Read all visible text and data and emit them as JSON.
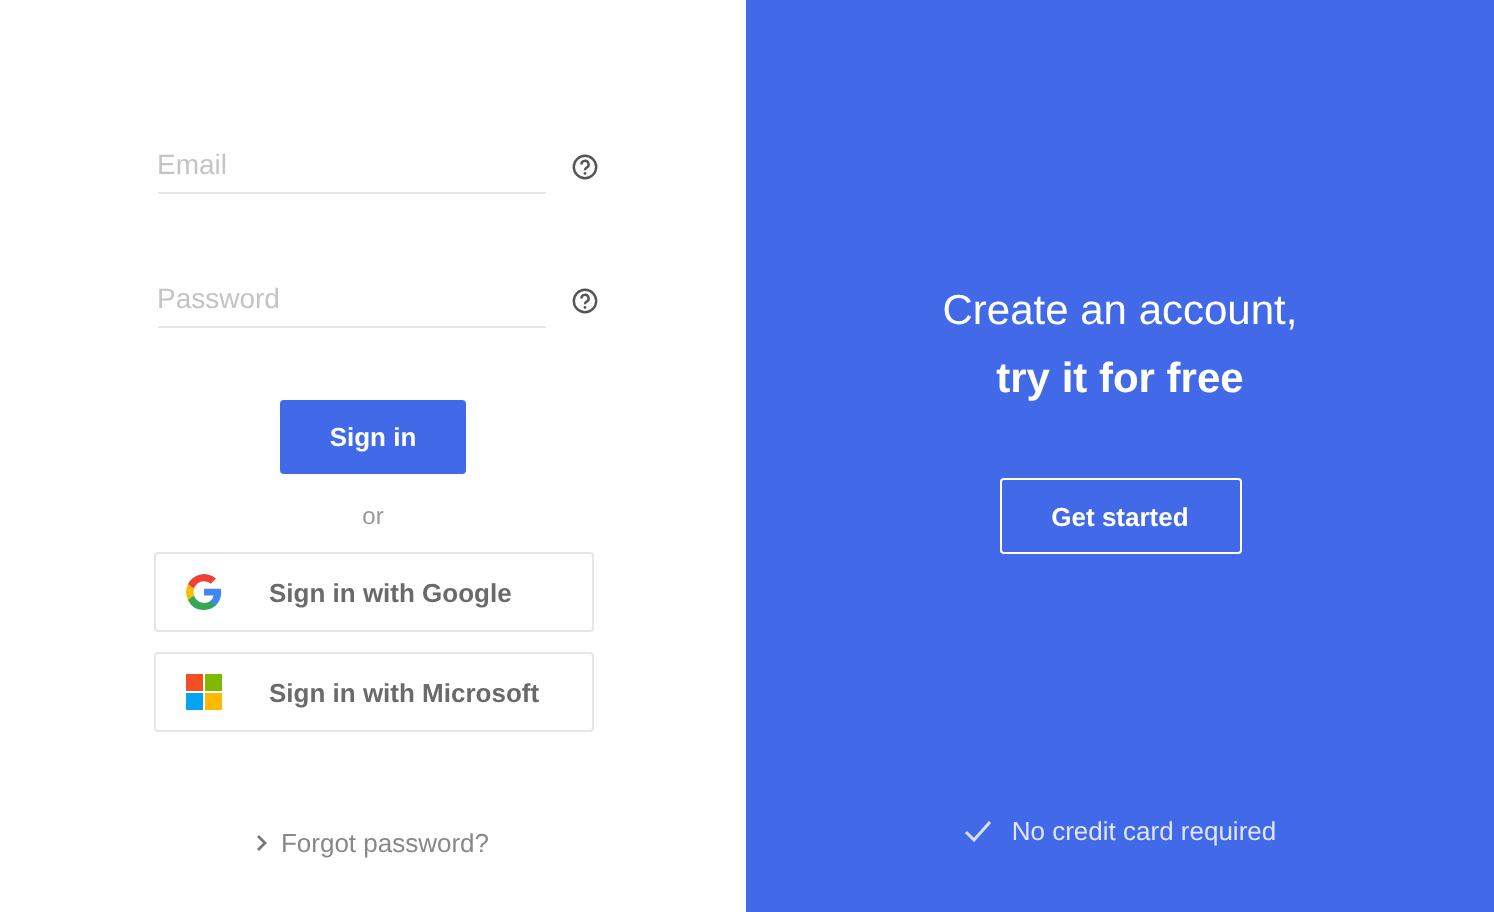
{
  "login": {
    "fields": [
      {
        "placeholder": "Email"
      },
      {
        "placeholder": "Password"
      }
    ],
    "sign_in_button": "Sign in",
    "separator": "or",
    "providers": [
      {
        "kind": "google",
        "label": "Sign in with Google"
      },
      {
        "kind": "microsoft",
        "label": "Sign in with Microsoft"
      }
    ],
    "forgot_link": "Forgot password?"
  },
  "promo": {
    "title": "Create an account,",
    "subtitle": "try it for free",
    "button": "Get started",
    "note": "No credit card required"
  }
}
